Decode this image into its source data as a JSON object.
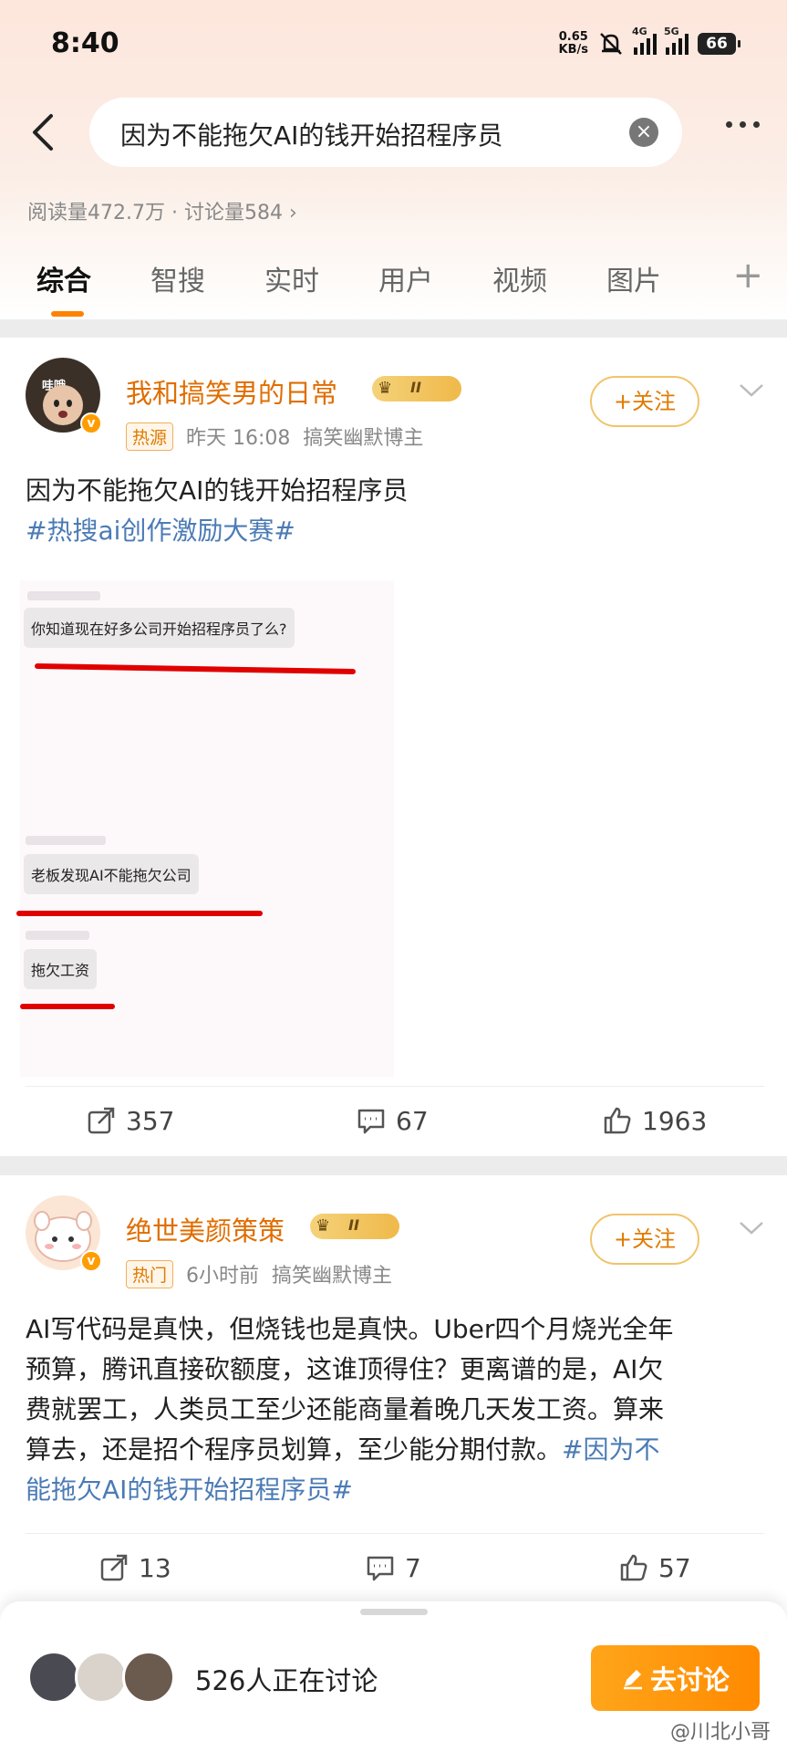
{
  "status_bar": {
    "time": "8:40",
    "net_speed_value": "0.65",
    "net_speed_unit": "KB/s",
    "signal_4g": "4G",
    "signal_5g": "5G",
    "battery": "66"
  },
  "search": {
    "query": "因为不能拖欠AI的钱开始招程序员"
  },
  "stats": {
    "text": "阅读量472.7万 · 讨论量584 ›"
  },
  "tabs": [
    {
      "label": "综合",
      "active": true
    },
    {
      "label": "智搜"
    },
    {
      "label": "实时"
    },
    {
      "label": "用户"
    },
    {
      "label": "视频"
    },
    {
      "label": "图片"
    }
  ],
  "posts": [
    {
      "avatar_text": "哇哦",
      "user_name": "我和搞笑男的日常",
      "vip_level": "II",
      "tag": "热源",
      "time": "昨天 16:08",
      "category": "搞笑幽默博主",
      "follow_label": "+关注",
      "text": "因为不能拖欠AI的钱开始招程序员",
      "hashtag": "#热搜ai创作激励大赛#",
      "image": {
        "bubble1": "你知道现在好多公司开始招程序员了么?",
        "bubble2": "老板发现AI不能拖欠公司",
        "bubble3": "拖欠工资"
      },
      "reposts": "357",
      "comments": "67",
      "likes": "1963"
    },
    {
      "user_name": "绝世美颜策策",
      "vip_level": "II",
      "tag": "热门",
      "time": "6小时前",
      "category": "搞笑幽默博主",
      "follow_label": "+关注",
      "text_line1": "AI写代码是真快，但烧钱也是真快。Uber四个月烧光全年",
      "text_line2": "预算，腾讯直接砍额度，这谁顶得住？更离谱的是，AI欠",
      "text_line3": "费就罢工，人类员工至少还能商量着晚几天发工资。算来",
      "text_line4_plain": "算去，还是招个程序员划算，至少能分期付款。",
      "text_line4_tag": "#因为不",
      "text_line5_tag": "能拖欠AI的钱开始招程序员#",
      "reposts": "13",
      "comments": "7",
      "likes": "57"
    }
  ],
  "bottom": {
    "discussing": "526人正在讨论",
    "button": "去讨论"
  },
  "watermark": "@川北小哥",
  "colors": {
    "accent": "#ff8200",
    "link": "#4b7bb5",
    "name": "#e06e00"
  }
}
